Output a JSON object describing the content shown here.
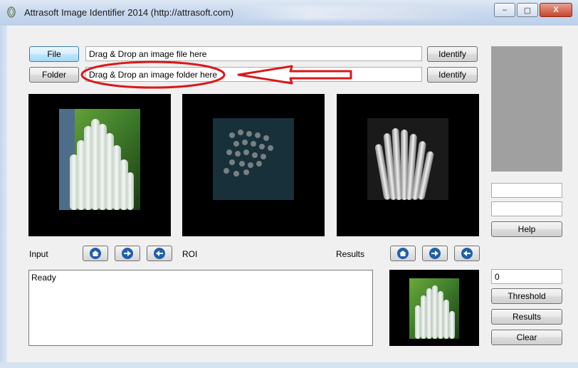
{
  "window": {
    "title": "Attrasoft Image Identifier 2014 (http://attrasoft.com)",
    "minimize": "–",
    "maximize": "▢",
    "close": "X"
  },
  "file_row": {
    "button": "File",
    "input_value": "Drag & Drop an image file here",
    "identify": "Identify"
  },
  "folder_row": {
    "button": "Folder",
    "input_value": "Drag & Drop an image folder here",
    "identify": "Identify"
  },
  "panels": {
    "input_label": "Input",
    "roi_label": "ROI",
    "results_label": "Results"
  },
  "log": {
    "text": "Ready"
  },
  "side": {
    "field1": "",
    "field2": "",
    "help": "Help",
    "threshold_value": "0",
    "threshold": "Threshold",
    "results": "Results",
    "clear": "Clear"
  },
  "icons": {
    "home": "home-icon",
    "forward": "arrow-right-icon",
    "back": "arrow-left-icon"
  },
  "colors": {
    "annotation": "#d81a1a",
    "nav_icon": "#1f5fa8"
  }
}
